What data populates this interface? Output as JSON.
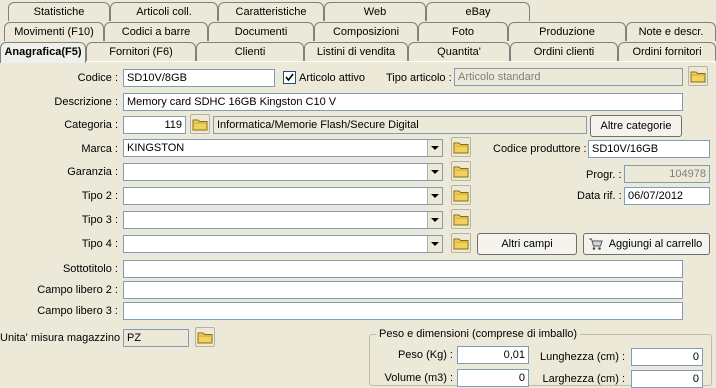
{
  "tabs": {
    "row1": [
      "Statistiche",
      "Articoli coll.",
      "Caratteristiche",
      "Web",
      "eBay"
    ],
    "row2": [
      "Movimenti (F10)",
      "Codici a barre",
      "Documenti",
      "Composizioni",
      "Foto",
      "Produzione",
      "Note e descr."
    ],
    "row3": [
      "Anagrafica(F5)",
      "Fornitori (F6)",
      "Clienti",
      "Listini di vendita",
      "Quantita'",
      "Ordini clienti",
      "Ordini fornitori"
    ]
  },
  "form": {
    "codice_label": "Codice :",
    "codice_value": "SD10V/8GB",
    "articolo_attivo_label": "Articolo attivo",
    "tipo_articolo_label": "Tipo articolo :",
    "tipo_articolo_value": "Articolo standard",
    "descrizione_label": "Descrizione :",
    "descrizione_value": "Memory card SDHC 16GB Kingston C10 V",
    "categoria_label": "Categoria :",
    "categoria_code": "119",
    "categoria_path": "Informatica/Memorie Flash/Secure Digital",
    "altre_categorie": "Altre categorie",
    "marca_label": "Marca :",
    "marca_value": "KINGSTON",
    "codice_produttore_label": "Codice produttore :",
    "codice_produttore_value": "SD10V/16GB",
    "garanzia_label": "Garanzia :",
    "progr_label": "Progr. :",
    "progr_value": "104978",
    "tipo2_label": "Tipo 2 :",
    "data_rif_label": "Data rif. :",
    "data_rif_value": "06/07/2012",
    "tipo3_label": "Tipo 3 :",
    "tipo4_label": "Tipo 4 :",
    "altri_campi": "Altri campi",
    "aggiungi_carrello": "Aggiungi al carrello",
    "sottotitolo_label": "Sottotitolo :",
    "campo_libero2_label": "Campo libero 2 :",
    "campo_libero3_label": "Campo libero 3 :",
    "unita_label": "Unita' misura magazzino :",
    "unita_value": "PZ",
    "peso_group_title": "Peso e dimensioni (comprese di imballo)",
    "peso_label": "Peso (Kg) :",
    "peso_value": "0,01",
    "lunghezza_label": "Lunghezza (cm) :",
    "lunghezza_value": "0",
    "volume_label": "Volume (m3) :",
    "volume_value": "0",
    "larghezza_label": "Larghezza (cm) :",
    "larghezza_value": "0"
  },
  "colors": {
    "accent_tab": "#f0f0ea",
    "field_border": "#7f9db9",
    "folder": "#f2d25c"
  }
}
